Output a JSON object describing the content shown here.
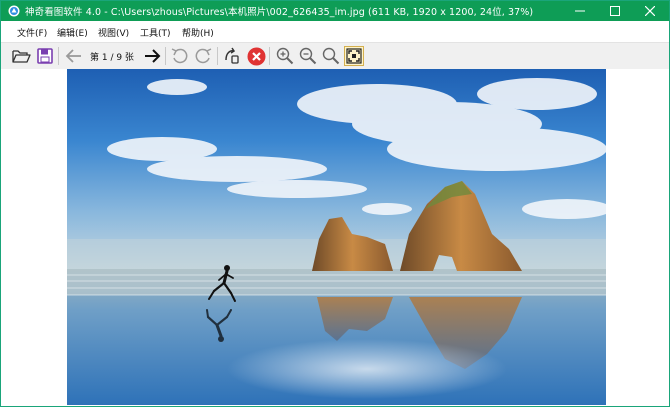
{
  "window": {
    "title": "神奇看图软件 4.0 - C:\\Users\\zhous\\Pictures\\本机照片\\002_626435_im.jpg (611 KB, 1920 x 1200, 24位, 37%)",
    "minimize_label": "—",
    "maximize_label": "☐",
    "close_label": "✕"
  },
  "menu": [
    {
      "label": "文件(F)"
    },
    {
      "label": "编辑(E)"
    },
    {
      "label": "视图(V)"
    },
    {
      "label": "工具(T)"
    },
    {
      "label": "帮助(H)"
    }
  ],
  "toolbar": {
    "page_indicator": "第 1 / 9 张",
    "icons": [
      "open-folder-icon",
      "save-icon",
      "previous-arrow-icon",
      "next-arrow-icon",
      "rotate-left-icon",
      "rotate-right-icon",
      "recycle-icon",
      "delete-icon",
      "zoom-in-icon",
      "zoom-out-icon",
      "actual-size-icon",
      "fit-window-icon"
    ]
  },
  "image": {
    "file": "002_626435_im.jpg",
    "size": "611 KB",
    "dimensions": "1920 x 1200",
    "bit_depth": "24位",
    "zoom": "37%"
  },
  "colors": {
    "titlebar": "#0e9d56",
    "delete": "#e03333",
    "toolbar": "#f0f0f0"
  }
}
